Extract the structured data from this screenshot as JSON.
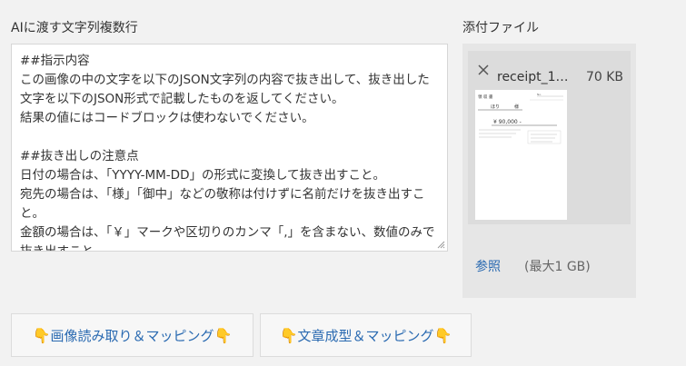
{
  "prompt": {
    "label": "AIに渡す文字列複数行",
    "text": "##指示内容\nこの画像の中の文字を以下のJSON文字列の内容で抜き出して、抜き出した文字を以下のJSON形式で記載したものを返してください。\n結果の値にはコードブロックは使わないでください。\n\n##抜き出しの注意点\n日付の場合は、「YYYY-MM-DD」の形式に変換して抜き出すこと。\n宛先の場合は、「様」「御中」などの敬称は付けずに名前だけを抜き出すこと。\n金額の場合は、「￥」マークや区切りのカンマ「,」を含まない、数値のみで抜き出すこと。"
  },
  "attachments": {
    "label": "添付ファイル",
    "file": {
      "name": "receipt_1…",
      "size": "70 KB",
      "thumbnail": {
        "title": "領 収 書",
        "no_label": "No.",
        "recipient": "ほり",
        "honorific": "様",
        "amount": "¥ 90,000 -"
      }
    },
    "browse_label": "参照",
    "size_limit": "(最大1 GB)"
  },
  "buttons": {
    "image_mapping": "画像読み取り＆マッピング",
    "text_mapping": "文章成型＆マッピング",
    "hand_glyph": "👇"
  }
}
